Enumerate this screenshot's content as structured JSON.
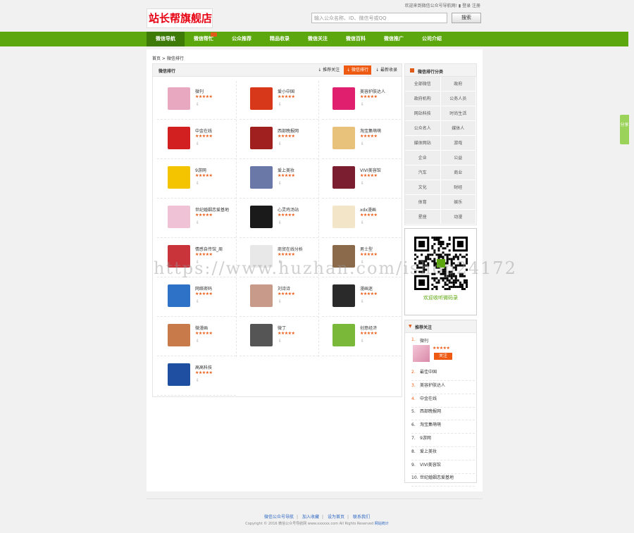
{
  "topbar": {
    "links": "欢迎来到微信公众号导航网! ▮ 登录 注册"
  },
  "header": {
    "logo": "站长帮旗舰店",
    "search_placeholder": "输入公众名称、ID、微信号或QQ",
    "search_btn": "搜索"
  },
  "nav": [
    {
      "label": "微信导航",
      "active": true
    },
    {
      "label": "微信帮忙",
      "hot": true
    },
    {
      "label": "公众推荐"
    },
    {
      "label": "精品收录"
    },
    {
      "label": "微信关注"
    },
    {
      "label": "微信百科"
    },
    {
      "label": "微信推广"
    },
    {
      "label": "公司介绍"
    }
  ],
  "breadcrumb": "首页 > 微信排行",
  "panel": {
    "title": "微信排行",
    "sort": [
      "↓ 推荐关注",
      "↓ 微信排行",
      "↓ 最新收录"
    ]
  },
  "accounts": [
    {
      "name": "微刊",
      "color": "#e8a8c0",
      "stars": "★★★★★",
      "dl": "⇩"
    },
    {
      "name": "爱小中国",
      "color": "#d8381a",
      "stars": "★★★★★",
      "dl": "⇩"
    },
    {
      "name": "美容护肤达人",
      "color": "#e0206e",
      "stars": "★★★★★",
      "dl": "⇩"
    },
    {
      "name": "中金在线",
      "color": "#d21f1f",
      "stars": "★★★★★",
      "dl": "⇩"
    },
    {
      "name": "西部晚报网",
      "color": "#a02020",
      "stars": "★★★★★",
      "dl": "⇩"
    },
    {
      "name": "淘宝集萌萌",
      "color": "#e8c27a",
      "stars": "★★★★★",
      "dl": "⇩"
    },
    {
      "name": "9游网",
      "color": "#f5c400",
      "stars": "★★★★★",
      "dl": "⇩"
    },
    {
      "name": "爱上美妆",
      "color": "#6a78a8",
      "stars": "★★★★★",
      "dl": "⇩"
    },
    {
      "name": "VIVI美容馆",
      "color": "#7a1e30",
      "stars": "★★★★★",
      "dl": "⇩"
    },
    {
      "name": "世纪婚姻恋爱基地",
      "color": "#f0c2d6",
      "stars": "★★★★★",
      "dl": "⇩"
    },
    {
      "name": "心灵鸡汤站",
      "color": "#1a1a1a",
      "stars": "★★★★★",
      "dl": "⇩"
    },
    {
      "name": "xdx漫画",
      "color": "#f3e6c8",
      "stars": "★★★★★",
      "dl": "⇩"
    },
    {
      "name": "情感自传馆_周",
      "color": "#c8343a",
      "stars": "★★★★★",
      "dl": "⇩"
    },
    {
      "name": "商贸在线分析",
      "color": "#e8e8e8",
      "stars": "★★★★★",
      "dl": "⇩"
    },
    {
      "name": "男士型",
      "color": "#8a6a4a",
      "stars": "★★★★★",
      "dl": "⇩"
    },
    {
      "name": "网络密码",
      "color": "#2e72c8",
      "stars": "★★★★★",
      "dl": "⇩"
    },
    {
      "name": "刘诗诗",
      "color": "#c89a8a",
      "stars": "★★★★★",
      "dl": "⇩"
    },
    {
      "name": "漫画迷",
      "color": "#2a2a2a",
      "stars": "★★★★★",
      "dl": "⇩"
    },
    {
      "name": "微漫画",
      "color": "#c87a4a",
      "stars": "★★★★★",
      "dl": "⇩"
    },
    {
      "name": "微丁",
      "color": "#555555",
      "stars": "★★★★★",
      "dl": "⇩"
    },
    {
      "name": "创意经济",
      "color": "#7ab83a",
      "stars": "★★★★★",
      "dl": "⇩"
    },
    {
      "name": "高高科技",
      "color": "#1e4fa0",
      "stars": "★★★★★",
      "dl": "⇩"
    }
  ],
  "side": {
    "cat_title": "微信排行分类",
    "categories": [
      "全部微信",
      "政府",
      "政府机构",
      "公务人员",
      "网站科技",
      "时尚生活",
      "公众名人",
      "媒体人",
      "媒体网站",
      "游戏",
      "企业",
      "公益",
      "汽车",
      "商业",
      "文化",
      "财经",
      "体育",
      "娱乐",
      "星座",
      "动漫"
    ],
    "qr_caption": "欢迎收听微码录",
    "rec_title": "推荐关注",
    "rec_first": {
      "num": "1.",
      "name": "微刊",
      "stars": "★★★★★",
      "follow": "关注"
    },
    "rec_list": [
      {
        "num": "2.",
        "name": "最佳中国"
      },
      {
        "num": "3.",
        "name": "美容护肤达人"
      },
      {
        "num": "4.",
        "name": "中金在线"
      },
      {
        "num": "5.",
        "name": "西部晚报网"
      },
      {
        "num": "6.",
        "name": "淘宝集萌萌"
      },
      {
        "num": "7.",
        "name": "9游网"
      },
      {
        "num": "8.",
        "name": "爱上美妆"
      },
      {
        "num": "9.",
        "name": "VIVI美容馆"
      },
      {
        "num": "10.",
        "name": "世纪婚姻恋爱基地"
      }
    ]
  },
  "float_tab": "分享",
  "footer": {
    "links": [
      "微信公众号导航",
      "加入收藏",
      "设为首页",
      "联系我们"
    ],
    "copyright": "Copyright © 2016 微信公众号导航网 www.xxxxxx.com All Rights Reserved",
    "icp": "网站统计"
  },
  "watermark": "https://www.huzhan.com/ishop24172"
}
